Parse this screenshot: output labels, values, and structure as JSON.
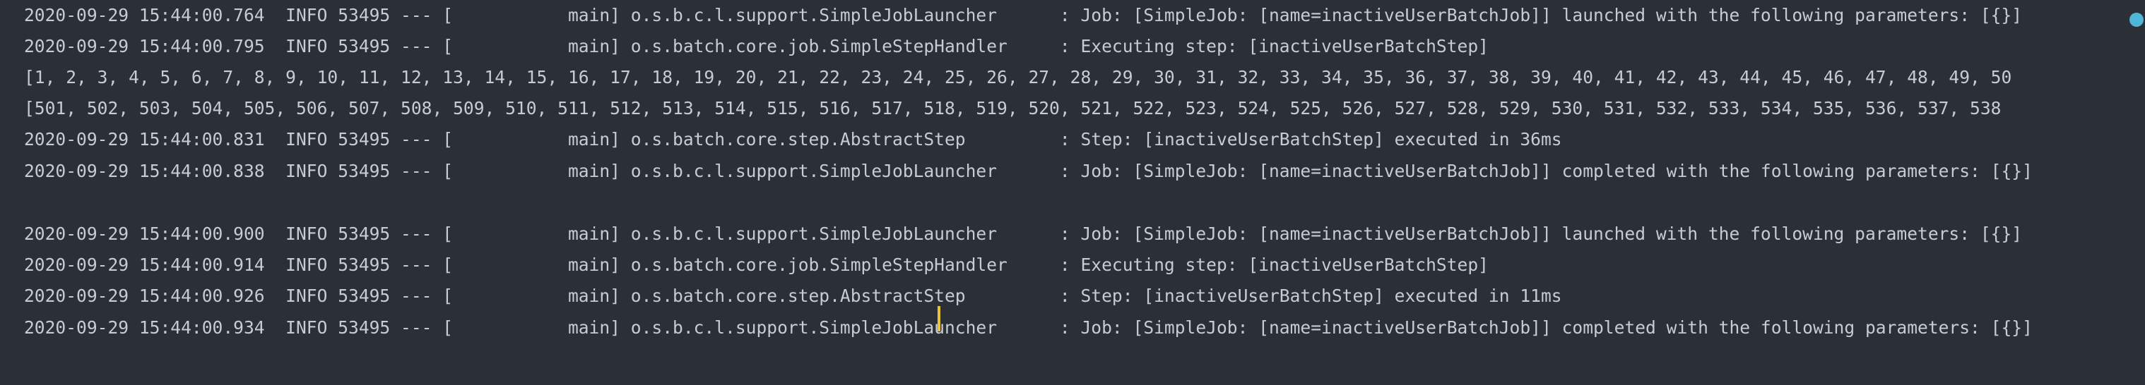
{
  "console": {
    "lines": [
      "2020-09-29 15:44:00.764  INFO 53495 --- [           main] o.s.b.c.l.support.SimpleJobLauncher      : Job: [SimpleJob: [name=inactiveUserBatchJob]] launched with the following parameters: [{}]",
      "2020-09-29 15:44:00.795  INFO 53495 --- [           main] o.s.batch.core.job.SimpleStepHandler     : Executing step: [inactiveUserBatchStep]",
      "[1, 2, 3, 4, 5, 6, 7, 8, 9, 10, 11, 12, 13, 14, 15, 16, 17, 18, 19, 20, 21, 22, 23, 24, 25, 26, 27, 28, 29, 30, 31, 32, 33, 34, 35, 36, 37, 38, 39, 40, 41, 42, 43, 44, 45, 46, 47, 48, 49, 50",
      "[501, 502, 503, 504, 505, 506, 507, 508, 509, 510, 511, 512, 513, 514, 515, 516, 517, 518, 519, 520, 521, 522, 523, 524, 525, 526, 527, 528, 529, 530, 531, 532, 533, 534, 535, 536, 537, 538",
      "2020-09-29 15:44:00.831  INFO 53495 --- [           main] o.s.batch.core.step.AbstractStep         : Step: [inactiveUserBatchStep] executed in 36ms",
      "2020-09-29 15:44:00.838  INFO 53495 --- [           main] o.s.b.c.l.support.SimpleJobLauncher      : Job: [SimpleJob: [name=inactiveUserBatchJob]] completed with the following parameters: [{}]",
      "",
      "2020-09-29 15:44:00.900  INFO 53495 --- [           main] o.s.b.c.l.support.SimpleJobLauncher      : Job: [SimpleJob: [name=inactiveUserBatchJob]] launched with the following parameters: [{}]",
      "2020-09-29 15:44:00.914  INFO 53495 --- [           main] o.s.batch.core.job.SimpleStepHandler     : Executing step: [inactiveUserBatchStep]",
      "2020-09-29 15:44:00.926  INFO 53495 --- [           main] o.s.batch.core.step.AbstractStep         : Step: [inactiveUserBatchStep] executed in 11ms",
      "2020-09-29 15:44:00.934  INFO 53495 --- [           main] o.s.b.c.l.support.SimpleJobLauncher      : Job: [SimpleJob: [name=inactiveUserBatchJob]] completed with the following parameters: [{}]"
    ]
  },
  "colors": {
    "background": "#2b2f36",
    "text": "#c5ccd6",
    "cursor": "#e8c23a",
    "indicator": "#4fb6d6"
  }
}
